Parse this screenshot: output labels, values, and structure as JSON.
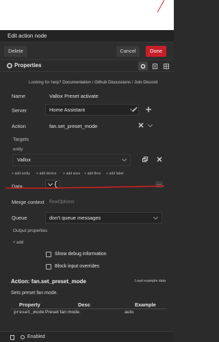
{
  "dialog": {
    "title": "Edit action node",
    "delete_label": "Delete",
    "cancel_label": "Cancel",
    "done_label": "Done"
  },
  "properties": {
    "title": "Properties",
    "help_prefix": "Looking for help?",
    "help_links": [
      "Documentation",
      "Github Discussions",
      "Join Discord"
    ]
  },
  "form": {
    "name_label": "Name",
    "name_value": "Vallox Preset activate",
    "server_label": "Server",
    "server_value": "Home Assistant",
    "action_label": "Action",
    "action_value": "fan.set_preset_mode",
    "targets_label": "Targets",
    "entity_label": "entity",
    "entity_value": "Vallox",
    "add_links": [
      "+ add entity",
      "+ add device",
      "+ add area",
      "+ add floor",
      "+ add label"
    ],
    "data_label": "Data",
    "merge_label": "Merge context",
    "merge_placeholder": "flowOptions",
    "queue_label": "Queue",
    "queue_value": "don't queue messages",
    "output_label": "Output properties",
    "output_add": "+ add",
    "debug_label": "Show debug information",
    "block_label": "Block input overrides"
  },
  "docs": {
    "title": "Action: fan.set_preset_mode",
    "load_example": "Load example data",
    "description": "Sets preset fan mode.",
    "columns": [
      "Property",
      "Desc",
      "Example"
    ],
    "rows": [
      {
        "property": "preset_mode",
        "desc": "Preset fan mode.",
        "example": "auto"
      }
    ]
  },
  "footer": {
    "enabled_label": "Enabled"
  },
  "colors": {
    "done_button": "#c71f2a",
    "annotation_line": "#e0201f"
  }
}
